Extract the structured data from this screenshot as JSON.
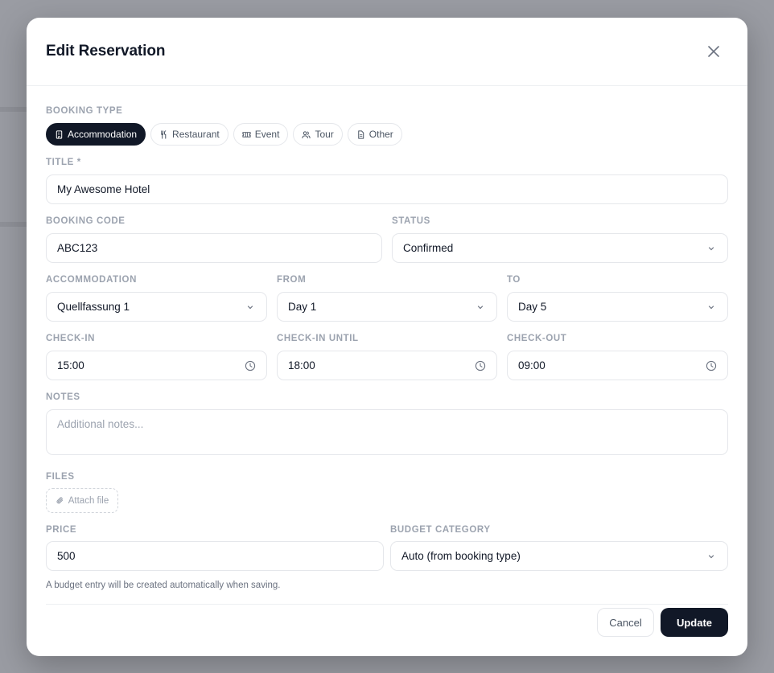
{
  "modal": {
    "title": "Edit Reservation",
    "close_icon": "close-icon"
  },
  "booking_type": {
    "label": "BOOKING TYPE",
    "options": [
      {
        "label": "Accommodation",
        "icon": "building-icon",
        "active": true
      },
      {
        "label": "Restaurant",
        "icon": "utensils-icon",
        "active": false
      },
      {
        "label": "Event",
        "icon": "ticket-icon",
        "active": false
      },
      {
        "label": "Tour",
        "icon": "users-icon",
        "active": false
      },
      {
        "label": "Other",
        "icon": "file-icon",
        "active": false
      }
    ]
  },
  "title_field": {
    "label": "TITLE *",
    "value": "My Awesome Hotel"
  },
  "booking_code": {
    "label": "BOOKING CODE",
    "value": "ABC123"
  },
  "status": {
    "label": "STATUS",
    "value": "Confirmed"
  },
  "accommodation": {
    "label": "ACCOMMODATION",
    "value": "Quellfassung 1"
  },
  "from": {
    "label": "FROM",
    "value": "Day 1"
  },
  "to": {
    "label": "TO",
    "value": "Day 5"
  },
  "check_in": {
    "label": "CHECK-IN",
    "value": "15:00"
  },
  "check_in_until": {
    "label": "CHECK-IN UNTIL",
    "value": "18:00"
  },
  "check_out": {
    "label": "CHECK-OUT",
    "value": "09:00"
  },
  "notes": {
    "label": "NOTES",
    "placeholder": "Additional notes..."
  },
  "files": {
    "label": "FILES",
    "attach_label": "Attach file"
  },
  "price": {
    "label": "PRICE",
    "value": "500"
  },
  "budget_category": {
    "label": "BUDGET CATEGORY",
    "value": "Auto (from booking type)"
  },
  "hint": "A budget entry will be created automatically when saving.",
  "actions": {
    "cancel": "Cancel",
    "update": "Update"
  },
  "colors": {
    "primary": "#111827",
    "border": "#e5e7eb",
    "label": "#9ca3af",
    "overlay": "#9a9ca3"
  }
}
